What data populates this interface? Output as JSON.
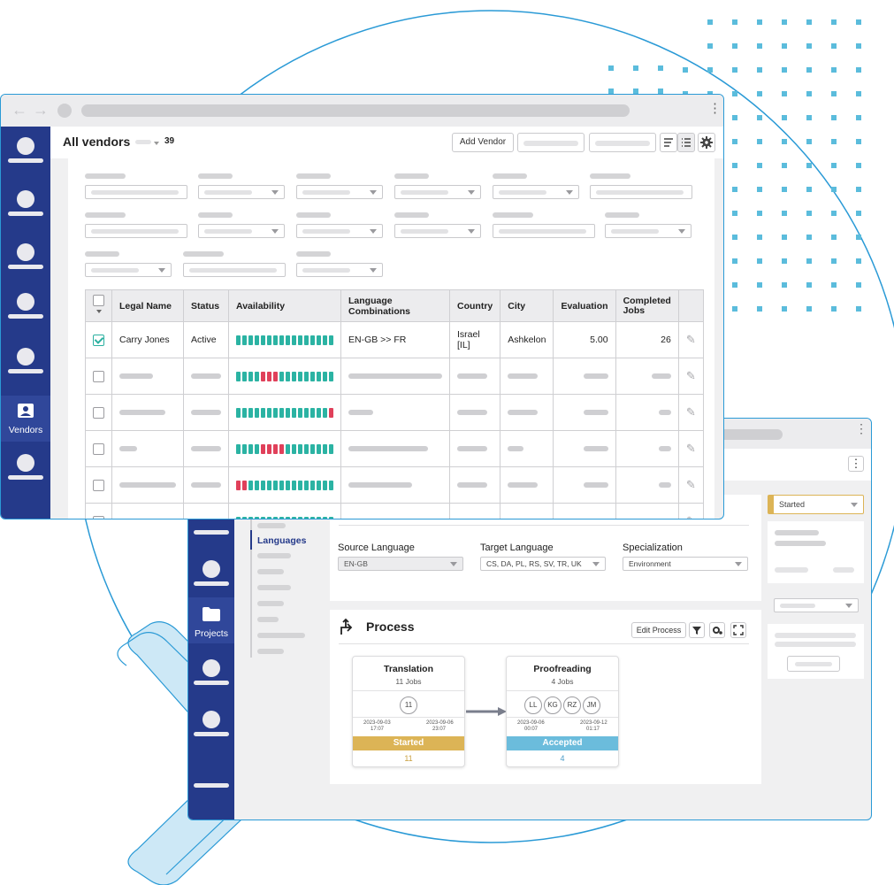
{
  "vendors_window": {
    "title": "All vendors",
    "count": "39",
    "add_vendor_label": "Add Vendor",
    "nav_active_label": "Vendors",
    "table": {
      "headers": [
        "Legal Name",
        "Status",
        "Availability",
        "Language Combinations",
        "Country",
        "City",
        "Evaluation",
        "Completed Jobs"
      ],
      "first_row": {
        "legal_name": "Carry Jones",
        "status": "Active",
        "language_combinations": "EN-GB >> FR",
        "country": "Israel [IL]",
        "city": "Ashkelon",
        "evaluation": "5.00",
        "completed_jobs": "26"
      }
    },
    "availability_pattern": [
      "gggggggggggggggg",
      "ggggrrrggggggggg",
      "gggggggggggggggr",
      "ggggrrrrgggggggg",
      "rrgggggggggggggg"
    ]
  },
  "project_window": {
    "nav_active_label": "Projects",
    "side_menu_active": "Languages",
    "source_language": {
      "label": "Source Language",
      "value": "EN-GB"
    },
    "target_language": {
      "label": "Target Language",
      "value": "CS, DA, PL, RS, SV, TR, UK"
    },
    "specialization": {
      "label": "Specialization",
      "value": "Environment"
    },
    "status_select": "Started",
    "process": {
      "title": "Process",
      "edit_label": "Edit Process",
      "steps": [
        {
          "name": "Translation",
          "jobs": "11 Jobs",
          "avatars": [
            "11"
          ],
          "start_date": "2023-09-03",
          "start_time": "17:07",
          "end_date": "2023-09-06",
          "end_time": "23:07",
          "status": "Started",
          "count": "11"
        },
        {
          "name": "Proofreading",
          "jobs": "4 Jobs",
          "avatars": [
            "LL",
            "KG",
            "RZ",
            "JM"
          ],
          "start_date": "2023-09-06",
          "start_time": "00:07",
          "end_date": "2023-09-12",
          "end_time": "01:17",
          "status": "Accepted",
          "count": "4"
        }
      ]
    }
  },
  "colors": {
    "nav": "#253a8a",
    "accent_teal": "#2bb3a3",
    "accent_red": "#e0405a",
    "started": "#dcb456",
    "accepted": "#6bbcdc",
    "frame_blue": "#2a9ad6",
    "chevron_fill": "#cde8f6"
  },
  "icons": [
    "back-arrow-icon",
    "forward-arrow-icon",
    "kebab-icon",
    "person-icon",
    "folder-icon",
    "pencil-icon",
    "filter-icon",
    "gear-icon",
    "expand-icon",
    "process-arrows-icon",
    "sort-icon",
    "list-icon"
  ]
}
